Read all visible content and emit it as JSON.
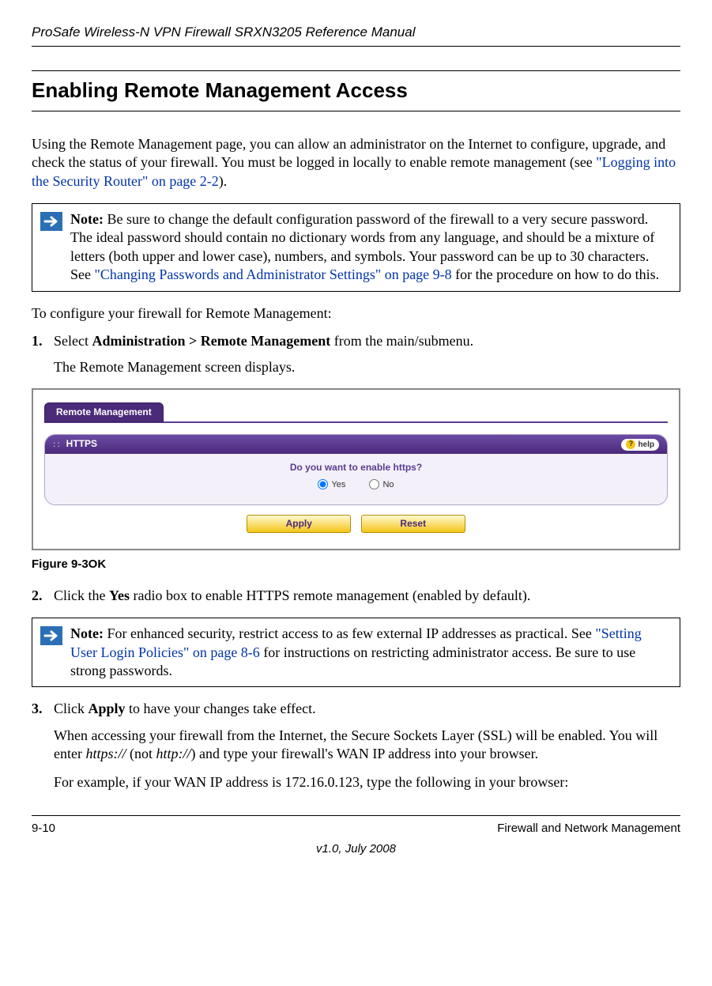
{
  "header": {
    "title": "ProSafe Wireless-N VPN Firewall SRXN3205 Reference Manual"
  },
  "section": {
    "heading": "Enabling Remote Management Access",
    "intro_pre": "Using the Remote Management page, you can allow an administrator on the Internet to configure, upgrade, and check the status of your firewall. You must be logged in locally to enable remote management (see ",
    "intro_link": "\"Logging into the Security Router\" on page 2-2",
    "intro_post": ")."
  },
  "note1": {
    "label": "Note:",
    "text_pre": " Be sure to change the default configuration password of the firewall to a very secure password. The ideal password should contain no dictionary words from any language, and should be a mixture of letters (both upper and lower case), numbers, and symbols. Your password can be up to 30 characters. See ",
    "link": "\"Changing Passwords and Administrator Settings\" on page 9-8",
    "text_post": " for the procedure on how to do this."
  },
  "config_intro": "To configure your firewall for Remote Management:",
  "steps": {
    "s1": {
      "num": "1.",
      "pre": "Select ",
      "bold": "Administration > Remote Management",
      "post": " from the main/submenu.",
      "sub": "The Remote Management screen displays."
    },
    "s2": {
      "num": "2.",
      "pre": "Click the ",
      "bold": "Yes",
      "post": " radio box to enable HTTPS remote management (enabled by default)."
    },
    "s3": {
      "num": "3.",
      "pre": "Click ",
      "bold": "Apply",
      "post": " to have your changes take effect.",
      "sub1_pre": "When accessing your firewall from the Internet, the Secure Sockets Layer (SSL) will be enabled. You will enter ",
      "sub1_i1": "https://",
      "sub1_mid": " (not ",
      "sub1_i2": "http://",
      "sub1_post": ") and type your firewall's WAN IP address into your browser.",
      "sub2": "For example, if your WAN IP address is 172.16.0.123, type the following in your browser:"
    }
  },
  "figure": {
    "tab": "Remote Management",
    "panel_title": "HTTPS",
    "help": "help",
    "question": "Do you want to enable https?",
    "yes": "Yes",
    "no": "No",
    "apply": "Apply",
    "reset": "Reset",
    "caption": "Figure 9-3OK"
  },
  "note2": {
    "label": "Note:",
    "text_pre": " For enhanced security, restrict access to as few external IP addresses as practical. See ",
    "link": "\"Setting User Login Policies\" on page 8-6",
    "text_post": " for instructions on restricting administrator access. Be sure to use strong passwords."
  },
  "footer": {
    "left": "9-10",
    "right": "Firewall and Network Management",
    "version": "v1.0, July 2008"
  }
}
